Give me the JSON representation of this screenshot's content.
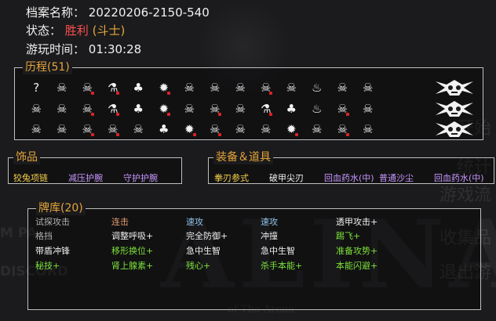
{
  "info": {
    "archive_label": "档案名称：",
    "archive_value": "20220206-2150-540",
    "status_label": "状态：",
    "status_result": "胜利",
    "status_class": "(斗士)",
    "time_label": "游玩时间：",
    "time_value": "01:30:28"
  },
  "history": {
    "title": "历程(51)",
    "rows": [
      [
        "question-icon",
        "skull-icon",
        "skull-meat-icon",
        "potion-icon",
        "chest-icon",
        "bomb-icon",
        "skull-icon",
        "skull-icon",
        "skull-icon",
        "skull-meat-icon",
        "horned-skull-icon",
        "trap-icon",
        "skull-icon",
        "skull-icon",
        "boss-icon"
      ],
      [
        "skull-icon",
        "skull-icon",
        "skull-meat-icon",
        "potion-icon",
        "chest-icon",
        "bomb-icon",
        "skull-icon",
        "skull-meat-icon",
        "skull-icon",
        "potion-icon",
        "chest-icon",
        "trap-icon",
        "skull-meat-icon",
        "skull-icon",
        "boss-icon"
      ],
      [
        "skull-icon",
        "skull-icon",
        "skull-meat-icon",
        "skull-meat-icon",
        "skull-icon",
        "chest-icon",
        "bomb-icon",
        "skull-meat-icon",
        "skull-icon",
        "skull-icon",
        "bomb-icon",
        "skull-icon",
        "skull-meat-icon",
        "skull-icon",
        "boss-icon"
      ]
    ],
    "glyphs": {
      "question-icon": "?",
      "skull-icon": "☠",
      "skull-meat-icon": "☠",
      "potion-icon": "⚗",
      "chest-icon": "♣",
      "bomb-icon": "✹",
      "horned-skull-icon": "☠",
      "trap-icon": "♨",
      "boss-icon": ""
    }
  },
  "accessories": {
    "title": "饰品",
    "items": [
      "狡兔项链",
      "减压护腕",
      "守护护腕"
    ]
  },
  "equipment": {
    "title": "装备＆道具",
    "items": [
      "拳刃参式",
      "破甲尖刃",
      "回血药水(中)",
      "普通沙尘",
      "回血药水(中)"
    ]
  },
  "deck": {
    "title": "牌库(20)",
    "columns": [
      [
        "试探攻击",
        "格挡",
        "带盾冲锋",
        "秘技+"
      ],
      [
        "连击",
        "调整呼吸+",
        "移形换位+",
        "肾上腺素+"
      ],
      [
        "速攻",
        "完全防御+",
        "急中生智",
        "残心+"
      ],
      [
        "速攻",
        "冲撞",
        "急中生智",
        "杀手本能+"
      ],
      [
        "透甲攻击+",
        "踢飞+",
        "准备攻势+",
        "本能闪避+"
      ]
    ]
  },
  "background": {
    "title": "ALINA",
    "subtitle": "of The Arena",
    "left_1": "M PA",
    "left_2": "DISCORD",
    "right_1": "统计",
    "right_2": "游戏流",
    "right_3": "收集品",
    "right_4": "退出游",
    "right_5": "开始"
  },
  "colors": {
    "title_orange": "#e5a53a",
    "victory_red": "#ff5050",
    "rare_yellow": "#f5d04a",
    "epic_purple": "#c896ff",
    "upgraded_green": "#7ce13a"
  }
}
